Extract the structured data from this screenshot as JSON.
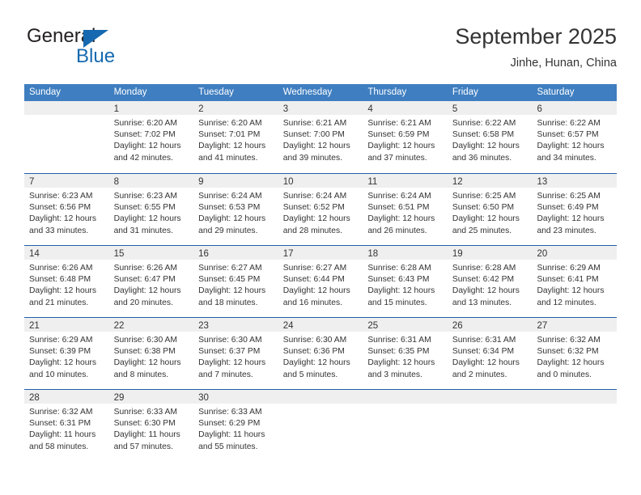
{
  "logo": {
    "primary_text": "General",
    "secondary_text": "Blue",
    "primary_color": "#231f20",
    "secondary_color": "#1669b0"
  },
  "header": {
    "title": "September 2025",
    "subtitle": "Jinhe, Hunan, China"
  },
  "theme": {
    "header_bg": "#3f7ec0",
    "header_text": "#ffffff",
    "row_divider": "#1f5fa9",
    "day_band_bg": "#efefef",
    "body_text": "#333333"
  },
  "calendar": {
    "weekday_headers": [
      "Sunday",
      "Monday",
      "Tuesday",
      "Wednesday",
      "Thursday",
      "Friday",
      "Saturday"
    ],
    "weeks": [
      [
        {
          "day": "",
          "lines": []
        },
        {
          "day": "1",
          "lines": [
            "Sunrise: 6:20 AM",
            "Sunset: 7:02 PM",
            "Daylight: 12 hours",
            "and 42 minutes."
          ]
        },
        {
          "day": "2",
          "lines": [
            "Sunrise: 6:20 AM",
            "Sunset: 7:01 PM",
            "Daylight: 12 hours",
            "and 41 minutes."
          ]
        },
        {
          "day": "3",
          "lines": [
            "Sunrise: 6:21 AM",
            "Sunset: 7:00 PM",
            "Daylight: 12 hours",
            "and 39 minutes."
          ]
        },
        {
          "day": "4",
          "lines": [
            "Sunrise: 6:21 AM",
            "Sunset: 6:59 PM",
            "Daylight: 12 hours",
            "and 37 minutes."
          ]
        },
        {
          "day": "5",
          "lines": [
            "Sunrise: 6:22 AM",
            "Sunset: 6:58 PM",
            "Daylight: 12 hours",
            "and 36 minutes."
          ]
        },
        {
          "day": "6",
          "lines": [
            "Sunrise: 6:22 AM",
            "Sunset: 6:57 PM",
            "Daylight: 12 hours",
            "and 34 minutes."
          ]
        }
      ],
      [
        {
          "day": "7",
          "lines": [
            "Sunrise: 6:23 AM",
            "Sunset: 6:56 PM",
            "Daylight: 12 hours",
            "and 33 minutes."
          ]
        },
        {
          "day": "8",
          "lines": [
            "Sunrise: 6:23 AM",
            "Sunset: 6:55 PM",
            "Daylight: 12 hours",
            "and 31 minutes."
          ]
        },
        {
          "day": "9",
          "lines": [
            "Sunrise: 6:24 AM",
            "Sunset: 6:53 PM",
            "Daylight: 12 hours",
            "and 29 minutes."
          ]
        },
        {
          "day": "10",
          "lines": [
            "Sunrise: 6:24 AM",
            "Sunset: 6:52 PM",
            "Daylight: 12 hours",
            "and 28 minutes."
          ]
        },
        {
          "day": "11",
          "lines": [
            "Sunrise: 6:24 AM",
            "Sunset: 6:51 PM",
            "Daylight: 12 hours",
            "and 26 minutes."
          ]
        },
        {
          "day": "12",
          "lines": [
            "Sunrise: 6:25 AM",
            "Sunset: 6:50 PM",
            "Daylight: 12 hours",
            "and 25 minutes."
          ]
        },
        {
          "day": "13",
          "lines": [
            "Sunrise: 6:25 AM",
            "Sunset: 6:49 PM",
            "Daylight: 12 hours",
            "and 23 minutes."
          ]
        }
      ],
      [
        {
          "day": "14",
          "lines": [
            "Sunrise: 6:26 AM",
            "Sunset: 6:48 PM",
            "Daylight: 12 hours",
            "and 21 minutes."
          ]
        },
        {
          "day": "15",
          "lines": [
            "Sunrise: 6:26 AM",
            "Sunset: 6:47 PM",
            "Daylight: 12 hours",
            "and 20 minutes."
          ]
        },
        {
          "day": "16",
          "lines": [
            "Sunrise: 6:27 AM",
            "Sunset: 6:45 PM",
            "Daylight: 12 hours",
            "and 18 minutes."
          ]
        },
        {
          "day": "17",
          "lines": [
            "Sunrise: 6:27 AM",
            "Sunset: 6:44 PM",
            "Daylight: 12 hours",
            "and 16 minutes."
          ]
        },
        {
          "day": "18",
          "lines": [
            "Sunrise: 6:28 AM",
            "Sunset: 6:43 PM",
            "Daylight: 12 hours",
            "and 15 minutes."
          ]
        },
        {
          "day": "19",
          "lines": [
            "Sunrise: 6:28 AM",
            "Sunset: 6:42 PM",
            "Daylight: 12 hours",
            "and 13 minutes."
          ]
        },
        {
          "day": "20",
          "lines": [
            "Sunrise: 6:29 AM",
            "Sunset: 6:41 PM",
            "Daylight: 12 hours",
            "and 12 minutes."
          ]
        }
      ],
      [
        {
          "day": "21",
          "lines": [
            "Sunrise: 6:29 AM",
            "Sunset: 6:39 PM",
            "Daylight: 12 hours",
            "and 10 minutes."
          ]
        },
        {
          "day": "22",
          "lines": [
            "Sunrise: 6:30 AM",
            "Sunset: 6:38 PM",
            "Daylight: 12 hours",
            "and 8 minutes."
          ]
        },
        {
          "day": "23",
          "lines": [
            "Sunrise: 6:30 AM",
            "Sunset: 6:37 PM",
            "Daylight: 12 hours",
            "and 7 minutes."
          ]
        },
        {
          "day": "24",
          "lines": [
            "Sunrise: 6:30 AM",
            "Sunset: 6:36 PM",
            "Daylight: 12 hours",
            "and 5 minutes."
          ]
        },
        {
          "day": "25",
          "lines": [
            "Sunrise: 6:31 AM",
            "Sunset: 6:35 PM",
            "Daylight: 12 hours",
            "and 3 minutes."
          ]
        },
        {
          "day": "26",
          "lines": [
            "Sunrise: 6:31 AM",
            "Sunset: 6:34 PM",
            "Daylight: 12 hours",
            "and 2 minutes."
          ]
        },
        {
          "day": "27",
          "lines": [
            "Sunrise: 6:32 AM",
            "Sunset: 6:32 PM",
            "Daylight: 12 hours",
            "and 0 minutes."
          ]
        }
      ],
      [
        {
          "day": "28",
          "lines": [
            "Sunrise: 6:32 AM",
            "Sunset: 6:31 PM",
            "Daylight: 11 hours",
            "and 58 minutes."
          ]
        },
        {
          "day": "29",
          "lines": [
            "Sunrise: 6:33 AM",
            "Sunset: 6:30 PM",
            "Daylight: 11 hours",
            "and 57 minutes."
          ]
        },
        {
          "day": "30",
          "lines": [
            "Sunrise: 6:33 AM",
            "Sunset: 6:29 PM",
            "Daylight: 11 hours",
            "and 55 minutes."
          ]
        },
        {
          "day": "",
          "lines": []
        },
        {
          "day": "",
          "lines": []
        },
        {
          "day": "",
          "lines": []
        },
        {
          "day": "",
          "lines": []
        }
      ]
    ]
  }
}
